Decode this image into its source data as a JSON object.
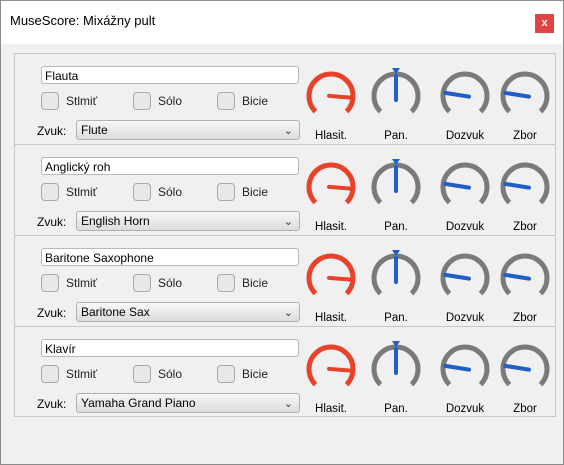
{
  "window": {
    "title": "MuseScore: Mixážny pult",
    "close_label": "x"
  },
  "labels": {
    "mute": "Stlmiť",
    "solo": "Sólo",
    "drums": "Bicie",
    "sound": "Zvuk:",
    "knobs": [
      "Hlasit.",
      "Pan.",
      "Dozvuk",
      "Zbor"
    ]
  },
  "colors": {
    "volume": "#e8432a",
    "pan_chorus": "#1f5fc6",
    "track": "#7a7a7a"
  },
  "strips": [
    {
      "name": "Flauta",
      "sound": "Flute",
      "mute": false,
      "solo": false,
      "drums": false,
      "volume": 0.85,
      "pan": 0.5,
      "reverb": 0.2,
      "chorus": 0.2
    },
    {
      "name": "Anglický roh",
      "sound": "English Horn",
      "mute": false,
      "solo": false,
      "drums": false,
      "volume": 0.85,
      "pan": 0.5,
      "reverb": 0.2,
      "chorus": 0.2
    },
    {
      "name": "Baritone Saxophone",
      "sound": "Baritone Sax",
      "mute": false,
      "solo": false,
      "drums": false,
      "volume": 0.85,
      "pan": 0.5,
      "reverb": 0.2,
      "chorus": 0.2
    },
    {
      "name": "Klavír",
      "sound": "Yamaha Grand Piano",
      "mute": false,
      "solo": false,
      "drums": false,
      "volume": 0.85,
      "pan": 0.5,
      "reverb": 0.2,
      "chorus": 0.2
    }
  ]
}
